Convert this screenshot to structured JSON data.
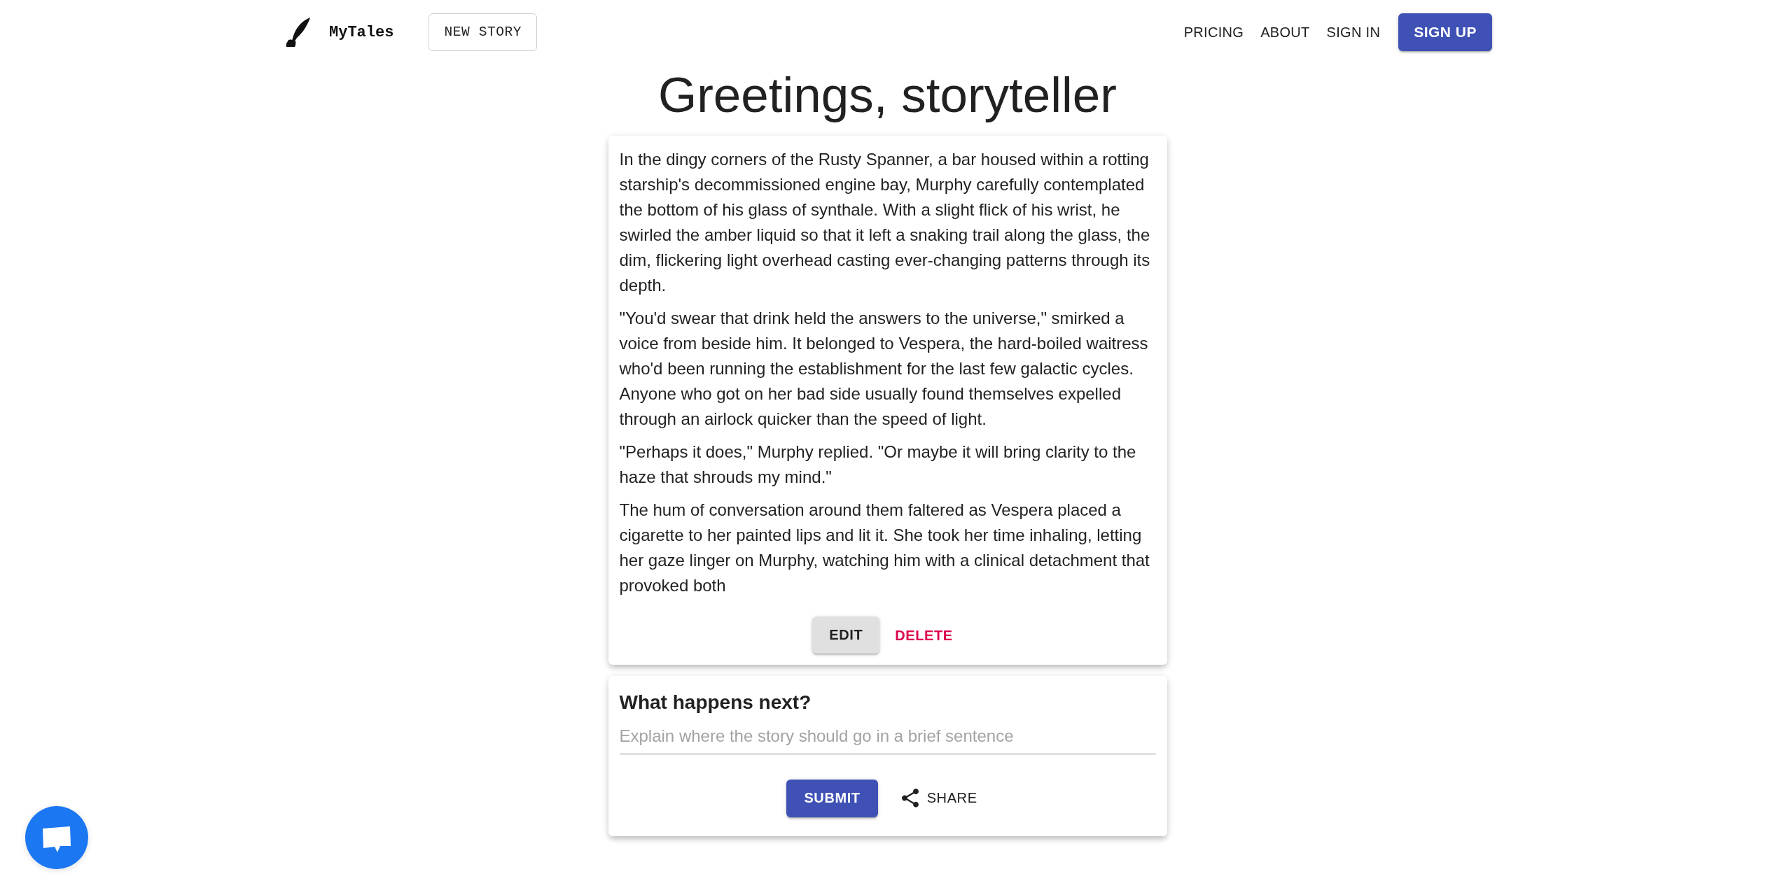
{
  "header": {
    "brand": "MyTales",
    "new_story_button": "NEW STORY",
    "nav_links": [
      "PRICING",
      "ABOUT",
      "SIGN IN"
    ],
    "sign_up_button": "SIGN UP"
  },
  "title": "Greetings, storyteller",
  "story_card": {
    "paragraphs": [
      "In the dingy corners of the Rusty Spanner, a bar housed within a rotting starship's decommissioned engine bay, Murphy carefully contemplated the bottom of his glass of synthale. With a slight flick of his wrist, he swirled the amber liquid so that it left a snaking trail along the glass, the dim, flickering light overhead casting ever-changing patterns through its depth.",
      "\"You'd swear that drink held the answers to the universe,\" smirked a voice from beside him. It belonged to Vespera, the hard-boiled waitress who'd been running the establishment for the last few galactic cycles. Anyone who got on her bad side usually found themselves expelled through an airlock quicker than the speed of light.",
      "\"Perhaps it does,\" Murphy replied. \"Or maybe it will bring clarity to the haze that shrouds my mind.\"",
      "The hum of conversation around them faltered as Vespera placed a cigarette to her painted lips and lit it. She took her time inhaling, letting her gaze linger on Murphy, watching him with a clinical detachment that provoked both"
    ],
    "actions": [
      {
        "label": "EDIT",
        "kind": "raised"
      },
      {
        "label": "DELETE",
        "kind": "danger"
      }
    ]
  },
  "prompt_card": {
    "heading": "What happens next?",
    "input": {
      "placeholder": "Explain where the story should go in a brief sentence"
    },
    "actions": [
      {
        "label": "SUBMIT",
        "kind": "primary"
      },
      {
        "label": "SHARE",
        "kind": "share"
      }
    ]
  }
}
